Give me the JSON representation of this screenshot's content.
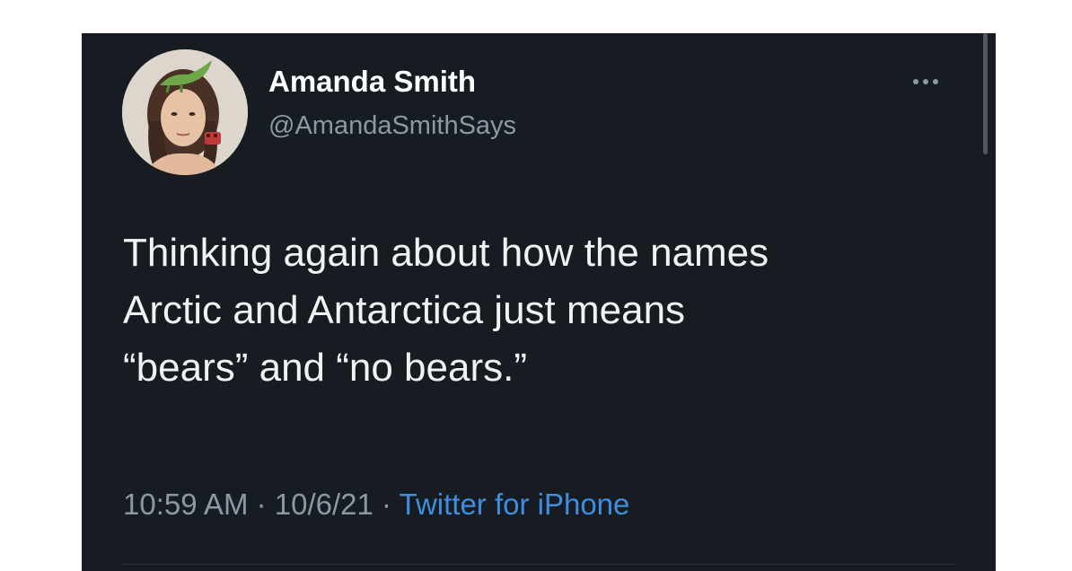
{
  "tweet": {
    "display_name": "Amanda Smith",
    "handle": "@AmandaSmithSays",
    "text_lines": [
      "Thinking again about how the names",
      "Arctic and Antarctica just means",
      "“bears” and “no bears.”"
    ],
    "time": "10:59 AM",
    "separator": " · ",
    "date": "10/6/21",
    "source": "Twitter for iPhone"
  },
  "icons": {
    "more": "more-horizontal-icon",
    "avatar": "profile-photo"
  },
  "colors": {
    "background": "#161c22",
    "text": "#f0f2f3",
    "secondary_text": "#8b98a5",
    "link": "#3f8fe0"
  }
}
